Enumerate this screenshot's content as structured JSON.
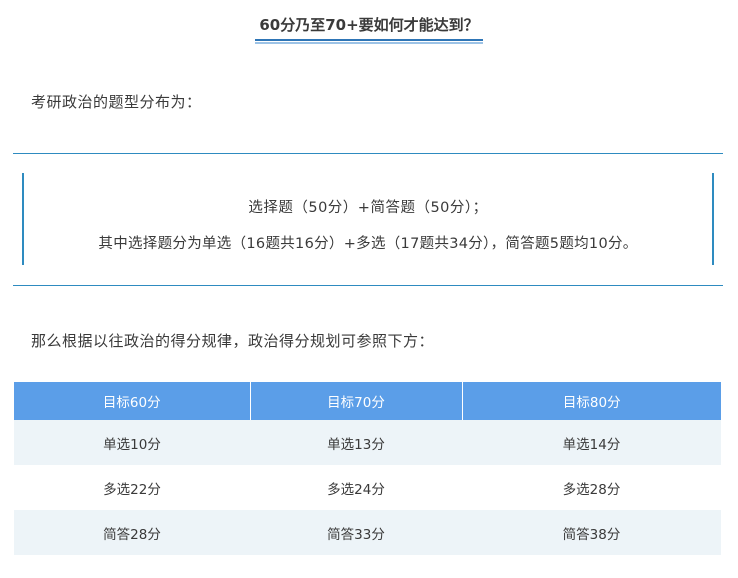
{
  "title": "60分乃至70+要如何才能达到？",
  "intro": "考研政治的题型分布为：",
  "quote": {
    "line1": "选择题（50分）+简答题（50分）；",
    "line2": "其中选择题分为单选（16题共16分）+多选（17题共34分），简答题5题均10分。"
  },
  "para2": "那么根据以往政治的得分规律，政治得分规划可参照下方：",
  "table": {
    "headers": [
      "目标60分",
      "目标70分",
      "目标80分"
    ],
    "rows": [
      [
        "单选10分",
        "单选13分",
        "单选14分"
      ],
      [
        "多选22分",
        "多选24分",
        "多选28分"
      ],
      [
        "简答28分",
        "简答33分",
        "简答38分"
      ]
    ]
  },
  "colors": {
    "accent": "#2e8bc0",
    "header_bg": "#5b9ee8",
    "alt_row_bg": "#edf4f8"
  }
}
